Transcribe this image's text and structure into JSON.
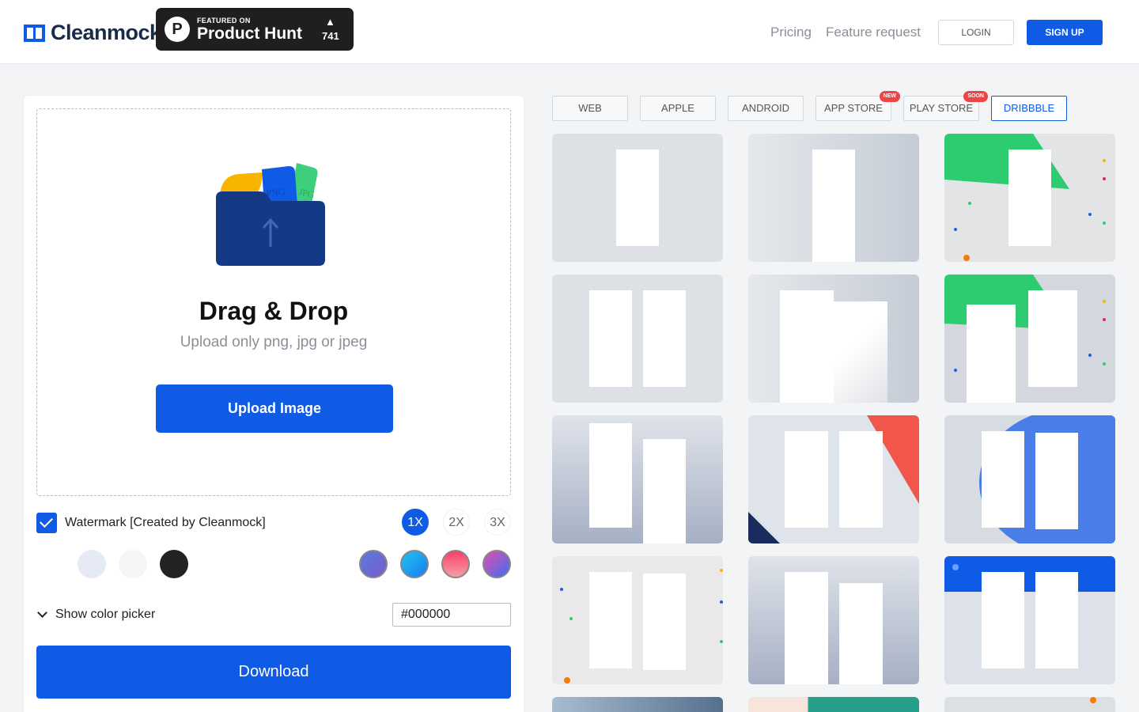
{
  "header": {
    "logo_text": "Cleanmock",
    "product_hunt": {
      "featured": "FEATURED ON",
      "name": "Product Hunt",
      "arrow": "▲",
      "count": "741"
    },
    "nav": {
      "pricing": "Pricing",
      "feature_request": "Feature request"
    },
    "login": "LOGIN",
    "signup": "SIGN UP"
  },
  "upload": {
    "title": "Drag & Drop",
    "subtitle": "Upload only png, jpg or jpeg",
    "button": "Upload Image",
    "illustration_labels": {
      "png": "PNG",
      "jpg": "JPG"
    }
  },
  "options": {
    "watermark_label": "Watermark [Created by Cleanmock]",
    "watermark_checked": true,
    "scales": [
      "1X",
      "2X",
      "3X"
    ],
    "selected_scale": "1X",
    "swatches": [
      "#e5eaf5",
      "#f5f5f5",
      "#222222",
      "linear-gradient(135deg,#5a7be0,#7a5bc8)",
      "linear-gradient(135deg,#1fa0f0,#1b7ff0)",
      "linear-gradient(135deg,#ff4f7a,#f0a0a0)",
      "linear-gradient(135deg,#e04fb0,#3f6ff0)"
    ],
    "color_picker_label": "Show color picker",
    "hex_value": "#000000"
  },
  "download_label": "Download",
  "tabs": [
    {
      "label": "WEB"
    },
    {
      "label": "APPLE"
    },
    {
      "label": "ANDROID"
    },
    {
      "label": "APP STORE",
      "tag": "NEW"
    },
    {
      "label": "PLAY STORE",
      "tag": "SOON"
    },
    {
      "label": "DRIBBBLE",
      "active": true
    }
  ],
  "colors": {
    "accent": "#0f5be6",
    "green": "#2ecc71",
    "red": "#f0564a",
    "orange": "#f57c00",
    "blue_shape": "#4a7de8"
  }
}
